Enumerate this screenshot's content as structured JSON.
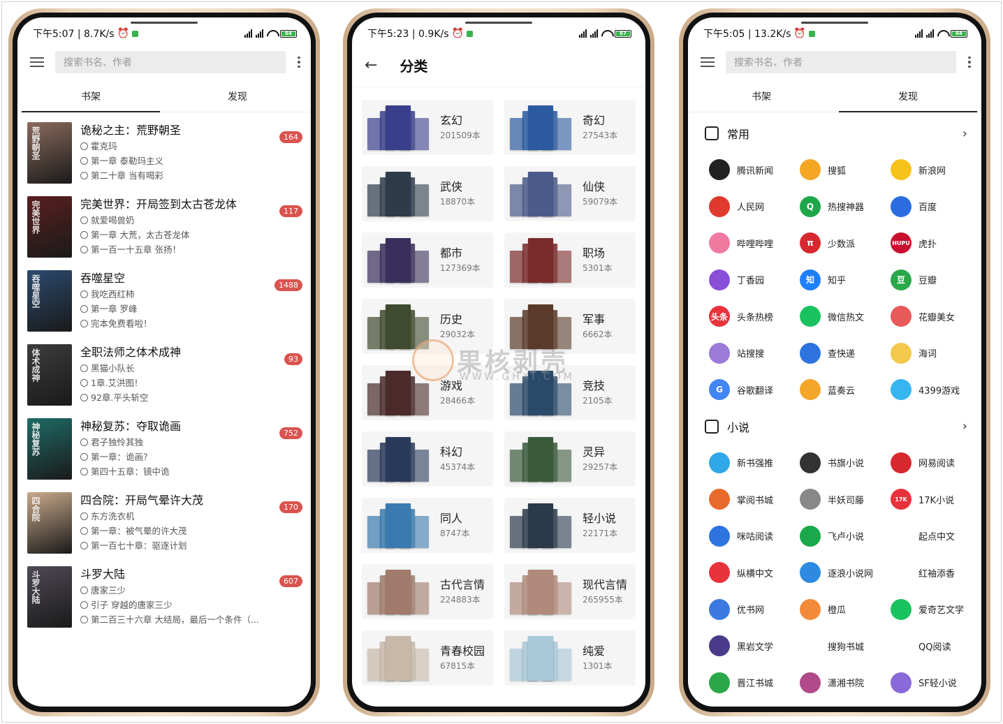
{
  "phone1": {
    "status": {
      "time": "下午5:07 | 8.7K/s",
      "battery": "64"
    },
    "search_placeholder": "搜索书名、作者",
    "tabs": [
      {
        "label": "书架",
        "active": true
      },
      {
        "label": "发现",
        "active": false
      }
    ],
    "books": [
      {
        "title": "诡秘之主：荒野朝圣",
        "author": "霍克玛",
        "read": "第一章 泰勒玛主义",
        "latest": "第二十章 当有喝彩",
        "badge": "164",
        "cover_text": "荒野朝圣",
        "cover_color": "#8a6a5c"
      },
      {
        "title": "完美世界：开局签到太古苍龙体",
        "author": "就爱喝兽奶",
        "read": "第一章 大荒，太古苍龙体",
        "latest": "第一百一十五章 张扬！",
        "badge": "117",
        "cover_text": "完美世界",
        "cover_color": "#5a1f1f"
      },
      {
        "title": "吞噬星空",
        "author": "我吃西红柿",
        "read": "第一章 罗峰",
        "latest": "完本免费看啦！",
        "badge": "1488",
        "cover_text": "吞噬星空",
        "cover_color": "#2b4a6e"
      },
      {
        "title": "全职法师之体术成神",
        "author": "黑猫小队长",
        "read": "1章.艾洪图！",
        "latest": "92章.平头斩空",
        "badge": "93",
        "cover_text": "体术成神",
        "cover_color": "#3c3c3c"
      },
      {
        "title": "神秘复苏：夺取诡画",
        "author": "君子独怜其独",
        "read": "第一章：诡画？",
        "latest": "第四十五章：镜中诡",
        "badge": "752",
        "cover_text": "神秘复苏",
        "cover_color": "#1e6b66"
      },
      {
        "title": "四合院：开局气晕许大茂",
        "author": "东方洗衣机",
        "read": "第一章：被气晕的许大茂",
        "latest": "第一百七十章：驱逐计划",
        "badge": "170",
        "cover_text": "四合院",
        "cover_color": "#c9a98a"
      },
      {
        "title": "斗罗大陆",
        "author": "唐家三少",
        "read": "引子 穿越的唐家三少",
        "latest": "第二百三十六章 大结局，最后一个条件（...",
        "badge": "607",
        "cover_text": "斗罗大陆",
        "cover_color": "#4f4a55"
      }
    ]
  },
  "phone2": {
    "status": {
      "time": "下午5:23 | 0.9K/s",
      "battery": "67"
    },
    "title": "分类",
    "categories": [
      {
        "name": "玄幻",
        "count": "201509本",
        "color": "#3a3f8c"
      },
      {
        "name": "奇幻",
        "count": "27543本",
        "color": "#2c5aa0"
      },
      {
        "name": "武侠",
        "count": "18870本",
        "color": "#2d3b4a"
      },
      {
        "name": "仙侠",
        "count": "59079本",
        "color": "#4a5a8a"
      },
      {
        "name": "都市",
        "count": "127369本",
        "color": "#3a2f5c"
      },
      {
        "name": "职场",
        "count": "5301本",
        "color": "#7a2a2a"
      },
      {
        "name": "历史",
        "count": "29032本",
        "color": "#3f4a2e"
      },
      {
        "name": "军事",
        "count": "6662本",
        "color": "#5a3a2a"
      },
      {
        "name": "游戏",
        "count": "28466本",
        "color": "#4a2a2a"
      },
      {
        "name": "竞技",
        "count": "2105本",
        "color": "#2a4a6a"
      },
      {
        "name": "科幻",
        "count": "45374本",
        "color": "#2a3a5a"
      },
      {
        "name": "灵异",
        "count": "29257本",
        "color": "#3a5a3a"
      },
      {
        "name": "同人",
        "count": "8747本",
        "color": "#3a7ab0"
      },
      {
        "name": "轻小说",
        "count": "22171本",
        "color": "#2a3a4a"
      },
      {
        "name": "古代言情",
        "count": "224883本",
        "color": "#a07a6a"
      },
      {
        "name": "现代言情",
        "count": "265955本",
        "color": "#b08a7a"
      },
      {
        "name": "青春校园",
        "count": "67815本",
        "color": "#c8b8a8"
      },
      {
        "name": "纯爱",
        "count": "1301本",
        "color": "#a8c8d8"
      }
    ]
  },
  "phone3": {
    "status": {
      "time": "下午5:05 | 13.2K/s",
      "battery": "64"
    },
    "search_placeholder": "搜索书名、作者",
    "tabs": [
      {
        "label": "书架",
        "active": false
      },
      {
        "label": "发现",
        "active": true
      }
    ],
    "sections": [
      {
        "title": "常用",
        "sources": [
          {
            "name": "腾讯新闻",
            "color": "#222222",
            "glyph": ""
          },
          {
            "name": "搜狐",
            "color": "#f5a623",
            "glyph": ""
          },
          {
            "name": "新浪网",
            "color": "#f7c21c",
            "glyph": ""
          },
          {
            "name": "人民网",
            "color": "#e03a2e",
            "glyph": ""
          },
          {
            "name": "热搜神器",
            "color": "#1fa64a",
            "glyph": "Q"
          },
          {
            "name": "百度",
            "color": "#2b6de0",
            "glyph": ""
          },
          {
            "name": "哔哩哔哩",
            "color": "#f27aa0",
            "glyph": ""
          },
          {
            "name": "少数派",
            "color": "#d7282f",
            "glyph": "π"
          },
          {
            "name": "虎扑",
            "color": "#c8102e",
            "glyph": "HUPU"
          },
          {
            "name": "丁香园",
            "color": "#8a4fd8",
            "glyph": ""
          },
          {
            "name": "知乎",
            "color": "#1e80ff",
            "glyph": "知"
          },
          {
            "name": "豆瓣",
            "color": "#2aa84a",
            "glyph": "豆"
          },
          {
            "name": "头条热榜",
            "color": "#e8323c",
            "glyph": "头条"
          },
          {
            "name": "微信热文",
            "color": "#19c25f",
            "glyph": ""
          },
          {
            "name": "花瓣美女",
            "color": "#e85a5a",
            "glyph": ""
          },
          {
            "name": "站搜搜",
            "color": "#9b7ad8",
            "glyph": ""
          },
          {
            "name": "查快递",
            "color": "#2d74e0",
            "glyph": ""
          },
          {
            "name": "海词",
            "color": "#f2c94c",
            "glyph": ""
          },
          {
            "name": "谷歌翻译",
            "color": "#4285f4",
            "glyph": "G"
          },
          {
            "name": "蓝奏云",
            "color": "#f4a62a",
            "glyph": ""
          },
          {
            "name": "4399游戏",
            "color": "#36b5f0",
            "glyph": ""
          }
        ]
      },
      {
        "title": "小说",
        "sources": [
          {
            "name": "新书强推",
            "color": "#2fa7e8",
            "glyph": ""
          },
          {
            "name": "书旗小说",
            "color": "#333333",
            "glyph": ""
          },
          {
            "name": "网易阅读",
            "color": "#d7282f",
            "glyph": ""
          },
          {
            "name": "掌阅书城",
            "color": "#e86a2a",
            "glyph": ""
          },
          {
            "name": "半妖司藤",
            "color": "#888888",
            "glyph": ""
          },
          {
            "name": "17K小说",
            "color": "#e8323c",
            "glyph": "17K"
          },
          {
            "name": "咪咕阅读",
            "color": "#2d74e0",
            "glyph": ""
          },
          {
            "name": "飞卢小说",
            "color": "#19a84a",
            "glyph": ""
          },
          {
            "name": "起点中文",
            "color": "",
            "glyph": ""
          },
          {
            "name": "纵横中文",
            "color": "#e8323c",
            "glyph": ""
          },
          {
            "name": "逐浪小说网",
            "color": "#2d8ae0",
            "glyph": ""
          },
          {
            "name": "红袖添香",
            "color": "",
            "glyph": ""
          },
          {
            "name": "优书网",
            "color": "#3a7ae0",
            "glyph": ""
          },
          {
            "name": "橙瓜",
            "color": "#f28a3a",
            "glyph": ""
          },
          {
            "name": "爱奇艺文学",
            "color": "#19c25f",
            "glyph": ""
          },
          {
            "name": "黑岩文学",
            "color": "#4a3a8a",
            "glyph": ""
          },
          {
            "name": "搜狗书城",
            "color": "",
            "glyph": ""
          },
          {
            "name": "QQ阅读",
            "color": "",
            "glyph": ""
          },
          {
            "name": "晋江书城",
            "color": "#2aa84a",
            "glyph": ""
          },
          {
            "name": "潇湘书院",
            "color": "#b04a8a",
            "glyph": ""
          },
          {
            "name": "SF轻小说",
            "color": "#8a6ad8",
            "glyph": ""
          }
        ]
      }
    ]
  },
  "watermark": {
    "text": "果核剥壳",
    "url": "WWW.GHXI.COM"
  }
}
